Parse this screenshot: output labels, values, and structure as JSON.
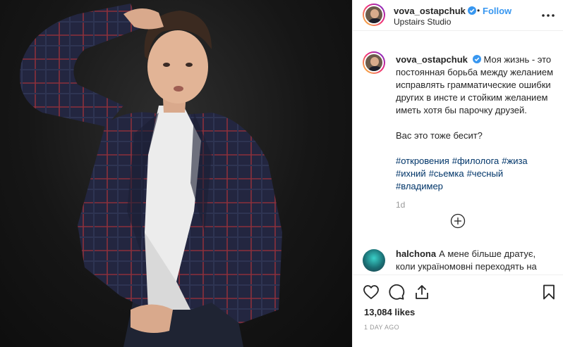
{
  "post": {
    "username": "vova_ostapchuk",
    "verified": true,
    "separator": "•",
    "follow_label": "Follow",
    "location": "Upstairs Studio"
  },
  "caption": {
    "username": "vova_ostapchuk",
    "text_first": "Моя жизнь - это постоянная борьба между желанием исправлять грамматические ошибки других в инсте и стойким желанием иметь хотя бы парочку друзей.",
    "text_second": "Вас это тоже бесит?",
    "hashtags": [
      "#откровения",
      "#филолога",
      "#жиза",
      "#ихний",
      "#сьемка",
      "#чесный",
      "#владимер"
    ],
    "time_ago": "1d"
  },
  "comment": {
    "username": "halchona",
    "text": "А мене більше дратує, коли україномовні переходять на"
  },
  "stats": {
    "likes": "13,084 likes",
    "date": "1 DAY AGO"
  },
  "icons": {
    "verified": "verified-badge-icon",
    "more": "more-options-icon",
    "load_more": "plus-circle-icon",
    "like": "heart-icon",
    "comment": "comment-bubble-icon",
    "share": "share-icon",
    "save": "bookmark-icon"
  },
  "colors": {
    "accent": "#3897f0",
    "hashtag": "#003569",
    "muted": "#999999",
    "text": "#262626",
    "verified": "#3897f0"
  }
}
